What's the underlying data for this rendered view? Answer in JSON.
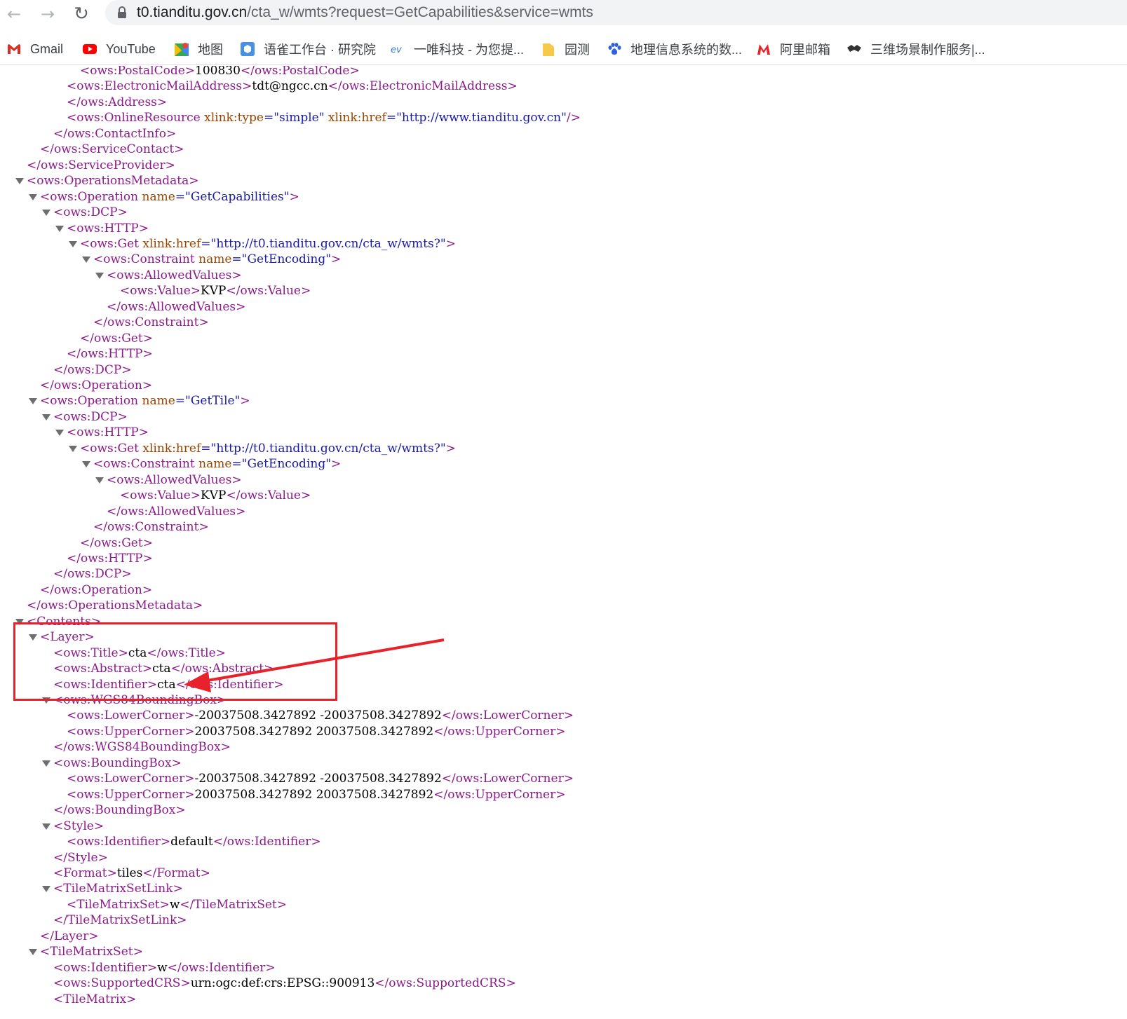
{
  "browser": {
    "url_host": "t0.tianditu.gov.cn",
    "url_rest": "/cta_w/wmts?request=GetCapabilities&service=wmts"
  },
  "bookmarks": [
    {
      "label": "Gmail",
      "icon": "gmail-icon",
      "color": "#d93025"
    },
    {
      "label": "YouTube",
      "icon": "youtube-icon",
      "color": "#ff0000"
    },
    {
      "label": "地图",
      "icon": "maps-icon",
      "color": "#34a853"
    },
    {
      "label": "语雀工作台 · 研究院",
      "icon": "yuque-icon",
      "color": "#4a90e2"
    },
    {
      "label": "一唯科技 - 为您提...",
      "icon": "ev-icon",
      "color": "#3b7bd6"
    },
    {
      "label": "园测",
      "icon": "folder-icon",
      "color": "#f7c948"
    },
    {
      "label": "地理信息系统的数...",
      "icon": "baidu-icon",
      "color": "#2f62e0"
    },
    {
      "label": "阿里邮箱",
      "icon": "alimail-icon",
      "color": "#e8222b"
    },
    {
      "label": "三维场景制作服务|...",
      "icon": "handshake-icon",
      "color": "#333333"
    }
  ],
  "xml": {
    "l01": {
      "open": "ows:PostalCode",
      "text": "100830",
      "close": "ows:PostalCode"
    },
    "l02": {
      "open": "ows:ElectronicMailAddress",
      "text": "tdt@ngcc.cn",
      "close": "ows:ElectronicMailAddress"
    },
    "l03": {
      "close": "ows:Address"
    },
    "l04": {
      "tag": "ows:OnlineResource",
      "a1": "xlink:type",
      "v1": "simple",
      "a2": "xlink:href",
      "v2": "http://www.tianditu.gov.cn"
    },
    "l05": {
      "close": "ows:ContactInfo"
    },
    "l06": {
      "close": "ows:ServiceContact"
    },
    "l07": {
      "close": "ows:ServiceProvider"
    },
    "l08": {
      "open": "ows:OperationsMetadata"
    },
    "l09": {
      "open": "ows:Operation",
      "a1": "name",
      "v1": "GetCapabilities"
    },
    "l10": {
      "open": "ows:DCP"
    },
    "l11": {
      "open": "ows:HTTP"
    },
    "l12": {
      "open": "ows:Get",
      "a1": "xlink:href",
      "v1": "http://t0.tianditu.gov.cn/cta_w/wmts?"
    },
    "l13": {
      "open": "ows:Constraint",
      "a1": "name",
      "v1": "GetEncoding"
    },
    "l14": {
      "open": "ows:AllowedValues"
    },
    "l15": {
      "open": "ows:Value",
      "text": "KVP",
      "close": "ows:Value"
    },
    "l16": {
      "close": "ows:AllowedValues"
    },
    "l17": {
      "close": "ows:Constraint"
    },
    "l18": {
      "close": "ows:Get"
    },
    "l19": {
      "close": "ows:HTTP"
    },
    "l20": {
      "close": "ows:DCP"
    },
    "l21": {
      "close": "ows:Operation"
    },
    "l22": {
      "open": "ows:Operation",
      "a1": "name",
      "v1": "GetTile"
    },
    "l23": {
      "open": "ows:DCP"
    },
    "l24": {
      "open": "ows:HTTP"
    },
    "l25": {
      "open": "ows:Get",
      "a1": "xlink:href",
      "v1": "http://t0.tianditu.gov.cn/cta_w/wmts?"
    },
    "l26": {
      "open": "ows:Constraint",
      "a1": "name",
      "v1": "GetEncoding"
    },
    "l27": {
      "open": "ows:AllowedValues"
    },
    "l28": {
      "open": "ows:Value",
      "text": "KVP",
      "close": "ows:Value"
    },
    "l29": {
      "close": "ows:AllowedValues"
    },
    "l30": {
      "close": "ows:Constraint"
    },
    "l31": {
      "close": "ows:Get"
    },
    "l32": {
      "close": "ows:HTTP"
    },
    "l33": {
      "close": "ows:DCP"
    },
    "l34": {
      "close": "ows:Operation"
    },
    "l35": {
      "close": "ows:OperationsMetadata"
    },
    "l36": {
      "open": "Contents"
    },
    "l37": {
      "open": "Layer"
    },
    "l38": {
      "open": "ows:Title",
      "text": "cta",
      "close": "ows:Title"
    },
    "l39": {
      "open": "ows:Abstract",
      "text": "cta",
      "close": "ows:Abstract"
    },
    "l40": {
      "open": "ows:Identifier",
      "text": "cta",
      "close": "ows:Identifier"
    },
    "l41": {
      "open": "ows:WGS84BoundingBox"
    },
    "l42": {
      "open": "ows:LowerCorner",
      "text": "-20037508.3427892 -20037508.3427892",
      "close": "ows:LowerCorner"
    },
    "l43": {
      "open": "ows:UpperCorner",
      "text": "20037508.3427892 20037508.3427892",
      "close": "ows:UpperCorner"
    },
    "l44": {
      "close": "ows:WGS84BoundingBox"
    },
    "l45": {
      "open": "ows:BoundingBox"
    },
    "l46": {
      "open": "ows:LowerCorner",
      "text": "-20037508.3427892 -20037508.3427892",
      "close": "ows:LowerCorner"
    },
    "l47": {
      "open": "ows:UpperCorner",
      "text": "20037508.3427892 20037508.3427892",
      "close": "ows:UpperCorner"
    },
    "l48": {
      "close": "ows:BoundingBox"
    },
    "l49": {
      "open": "Style"
    },
    "l50": {
      "open": "ows:Identifier",
      "text": "default",
      "close": "ows:Identifier"
    },
    "l51": {
      "close": "Style"
    },
    "l52": {
      "open": "Format",
      "text": "tiles",
      "close": "Format"
    },
    "l53": {
      "open": "TileMatrixSetLink"
    },
    "l54": {
      "open": "TileMatrixSet",
      "text": "w",
      "close": "TileMatrixSet"
    },
    "l55": {
      "close": "TileMatrixSetLink"
    },
    "l56": {
      "close": "Layer"
    },
    "l57": {
      "open": "TileMatrixSet"
    },
    "l58": {
      "open": "ows:Identifier",
      "text": "w",
      "close": "ows:Identifier"
    },
    "l59": {
      "open": "ows:SupportedCRS",
      "text": "urn:ogc:def:crs:EPSG::900913",
      "close": "ows:SupportedCRS"
    },
    "l60": {
      "open": "TileMatrix"
    }
  },
  "annotation_color": "#e8222b"
}
